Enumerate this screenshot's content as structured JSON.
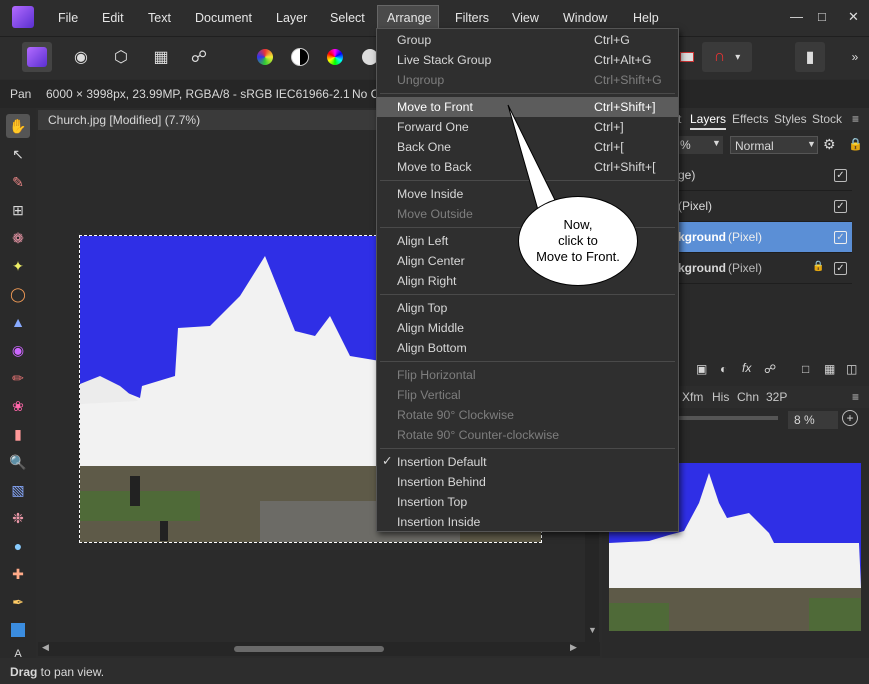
{
  "menubar": {
    "items": [
      "File",
      "Edit",
      "Text",
      "Document",
      "Layer",
      "Select",
      "Arrange",
      "Filters",
      "View",
      "Window",
      "Help"
    ],
    "active": "Arrange"
  },
  "context": {
    "tool": "Pan",
    "doc_info": "6000 × 3998px, 23.99MP, RGBA/8 - sRGB IEC61966-2.1",
    "truncated": "No C"
  },
  "document": {
    "tab_title": "Church.jpg [Modified] (7.7%)"
  },
  "arrange_menu": {
    "groups": [
      [
        {
          "label": "Group",
          "shortcut": "Ctrl+G",
          "enabled": true
        },
        {
          "label": "Live Stack Group",
          "shortcut": "Ctrl+Alt+G",
          "enabled": true
        },
        {
          "label": "Ungroup",
          "shortcut": "Ctrl+Shift+G",
          "enabled": false
        }
      ],
      [
        {
          "label": "Move to Front",
          "shortcut": "Ctrl+Shift+]",
          "enabled": true,
          "highlighted": true
        },
        {
          "label": "Forward One",
          "shortcut": "Ctrl+]",
          "enabled": true
        },
        {
          "label": "Back One",
          "shortcut": "Ctrl+[",
          "enabled": true
        },
        {
          "label": "Move to Back",
          "shortcut": "Ctrl+Shift+[",
          "enabled": true
        }
      ],
      [
        {
          "label": "Move Inside",
          "shortcut": "",
          "enabled": true
        },
        {
          "label": "Move Outside",
          "shortcut": "",
          "enabled": false
        }
      ],
      [
        {
          "label": "Align Left",
          "shortcut": "",
          "enabled": true
        },
        {
          "label": "Align Center",
          "shortcut": "",
          "enabled": true
        },
        {
          "label": "Align Right",
          "shortcut": "",
          "enabled": true
        }
      ],
      [
        {
          "label": "Align Top",
          "shortcut": "",
          "enabled": true
        },
        {
          "label": "Align Middle",
          "shortcut": "",
          "enabled": true
        },
        {
          "label": "Align Bottom",
          "shortcut": "",
          "enabled": true
        }
      ],
      [
        {
          "label": "Flip Horizontal",
          "shortcut": "",
          "enabled": false
        },
        {
          "label": "Flip Vertical",
          "shortcut": "",
          "enabled": false
        },
        {
          "label": "Rotate 90° Clockwise",
          "shortcut": "",
          "enabled": false
        },
        {
          "label": "Rotate 90° Counter-clockwise",
          "shortcut": "",
          "enabled": false
        }
      ],
      [
        {
          "label": "Insertion Default",
          "shortcut": "",
          "enabled": true,
          "checked": true
        },
        {
          "label": "Insertion Behind",
          "shortcut": "",
          "enabled": true
        },
        {
          "label": "Insertion Top",
          "shortcut": "",
          "enabled": true
        },
        {
          "label": "Insertion Inside",
          "shortcut": "",
          "enabled": true
        }
      ]
    ]
  },
  "callout": {
    "text": "Now,\nclick to\nMove to Front."
  },
  "layers_panel": {
    "tabs": [
      "t",
      "Layers",
      "Effects",
      "Styles",
      "Stock"
    ],
    "active_tab": "Layers",
    "opacity_partial": "%",
    "blend_mode": "Normal",
    "rows": [
      {
        "name": "ge)",
        "type": "",
        "selected": false,
        "locked": false
      },
      {
        "name": "(Pixel)",
        "type": "",
        "selected": false,
        "locked": false
      },
      {
        "name": "kground",
        "type": "(Pixel)",
        "selected": true,
        "locked": false
      },
      {
        "name": "kground",
        "type": "(Pixel)",
        "selected": false,
        "locked": true
      }
    ]
  },
  "navigator_panel": {
    "tabs": [
      "Xfm",
      "His",
      "Chn",
      "32P"
    ],
    "zoom": "8 %"
  },
  "status": {
    "bold": "Drag",
    "rest": " to pan view."
  },
  "colors": {
    "highlight_layer": "#5b8fd6",
    "menu_highlight": "#5c5c5c",
    "sky_blue": "#2f2fe6"
  }
}
